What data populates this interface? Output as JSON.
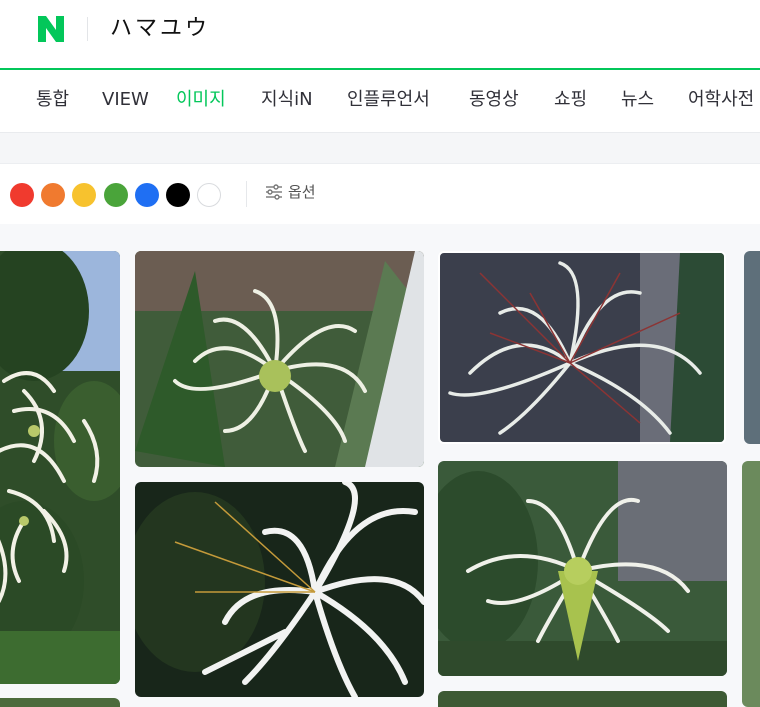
{
  "header": {
    "logo_letter": "N",
    "query": "ハマユウ"
  },
  "tabs": [
    {
      "label": "통합"
    },
    {
      "label": "VIEW"
    },
    {
      "label": "이미지",
      "active": true
    },
    {
      "label": "지식iN"
    },
    {
      "label": "인플루언서"
    },
    {
      "label": "동영상"
    },
    {
      "label": "쇼핑"
    },
    {
      "label": "뉴스"
    },
    {
      "label": "어학사전"
    }
  ],
  "filters": {
    "colors": [
      "#f03a2e",
      "#f07a2f",
      "#f7c22e",
      "#4aa43a",
      "#1f6ff3",
      "#000000",
      "#ffffff"
    ],
    "options_label": "옵션",
    "accent": "#03c75a"
  },
  "images": [
    {
      "id": "img-1",
      "alt": "crinum lily tall plant against sky"
    },
    {
      "id": "img-2",
      "alt": "white spider lily blossom"
    },
    {
      "id": "img-3",
      "alt": "spider lily with red stamens"
    },
    {
      "id": "img-4",
      "alt": "white spider lily petals close-up"
    },
    {
      "id": "img-5",
      "alt": "crinum flower cluster"
    }
  ]
}
